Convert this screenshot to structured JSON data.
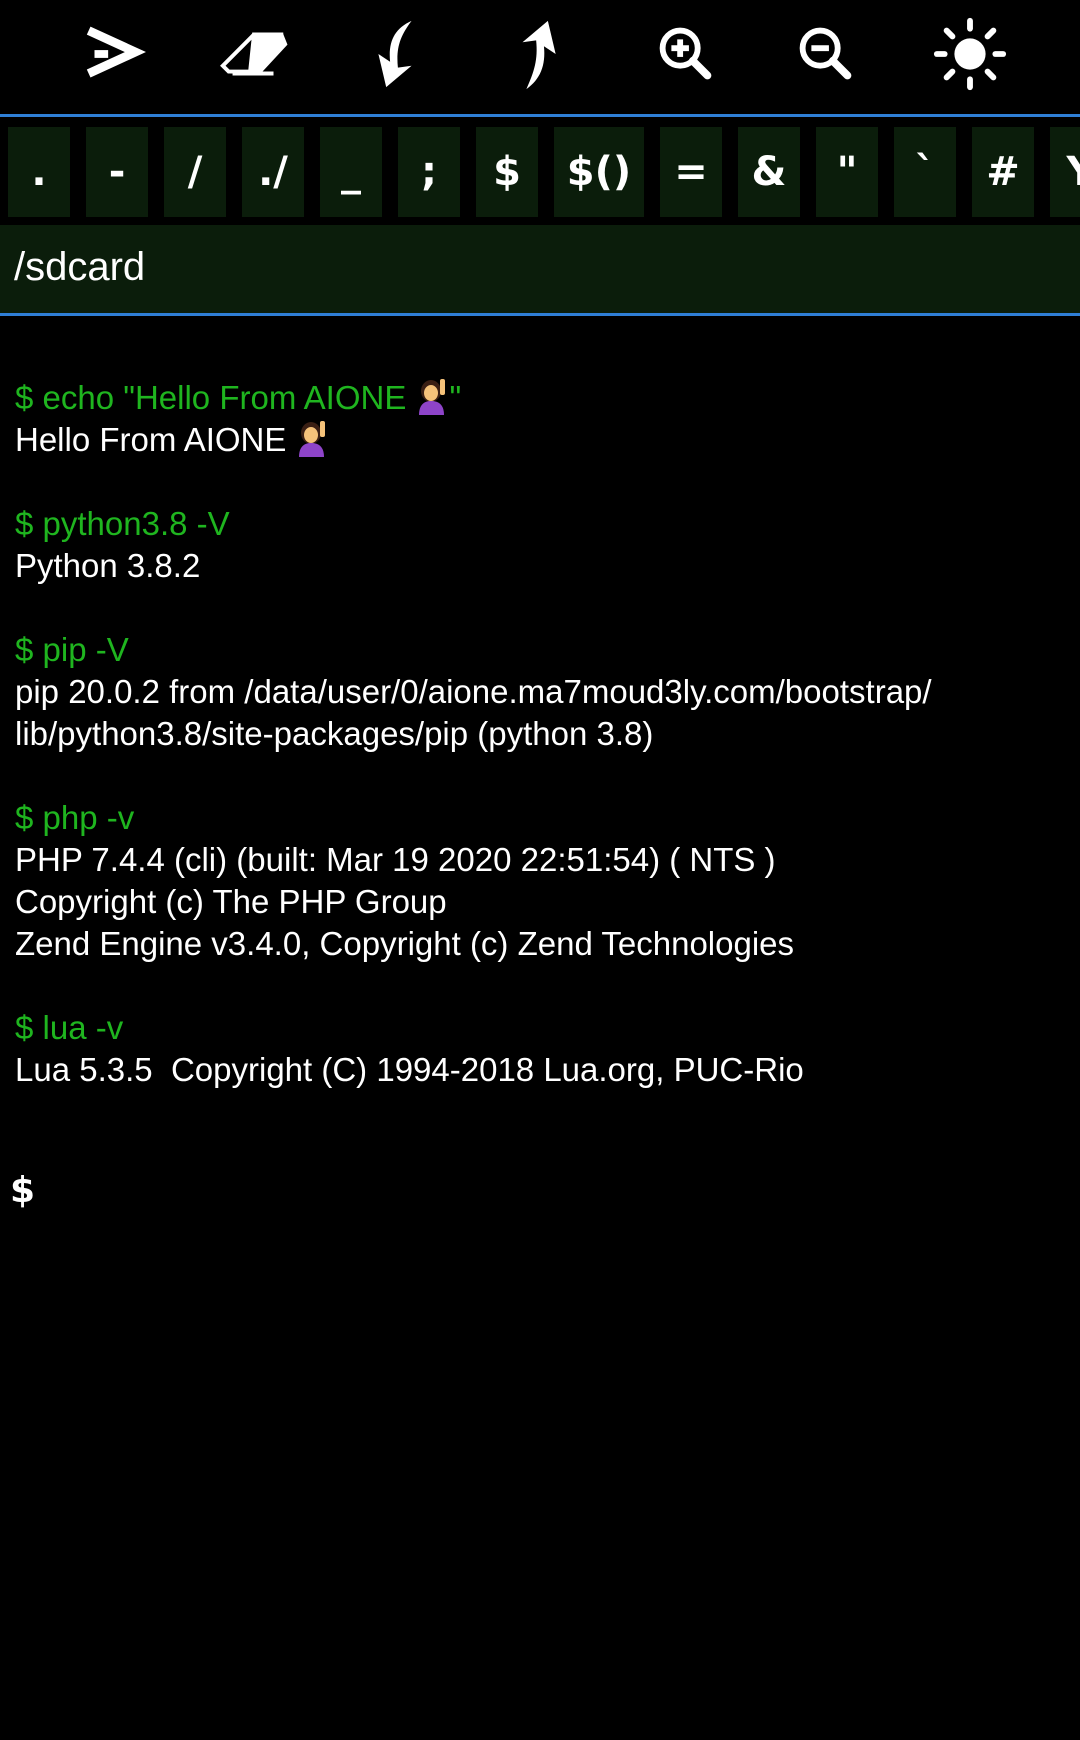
{
  "toolbar": {
    "icons": [
      "send-icon",
      "eraser-icon",
      "download-arrow-icon",
      "upload-arrow-icon",
      "zoom-in-icon",
      "zoom-out-icon",
      "brightness-icon"
    ]
  },
  "keys": [
    ".",
    "-",
    "/",
    "./",
    "_",
    ";",
    "$",
    "$()",
    "=",
    "&",
    "\"",
    "`",
    "#",
    "Y"
  ],
  "path": "/sdcard",
  "terminal": {
    "lines": [
      {
        "type": "cmd",
        "text": "$ echo \"Hello From AIONE ",
        "emoji": true,
        "suffix": "\""
      },
      {
        "type": "out",
        "text": "Hello From AIONE ",
        "emoji": true,
        "suffix": ""
      },
      {
        "type": "blank",
        "text": ""
      },
      {
        "type": "cmd",
        "text": "$ python3.8 -V"
      },
      {
        "type": "out",
        "text": "Python 3.8.2"
      },
      {
        "type": "blank",
        "text": ""
      },
      {
        "type": "cmd",
        "text": "$ pip -V"
      },
      {
        "type": "out",
        "text": "pip 20.0.2 from /data/user/0/aione.ma7moud3ly.com/bootstrap/"
      },
      {
        "type": "out",
        "text": "lib/python3.8/site-packages/pip (python 3.8)"
      },
      {
        "type": "blank",
        "text": ""
      },
      {
        "type": "cmd",
        "text": "$ php -v"
      },
      {
        "type": "out",
        "text": "PHP 7.4.4 (cli) (built: Mar 19 2020 22:51:54) ( NTS )"
      },
      {
        "type": "out",
        "text": "Copyright (c) The PHP Group"
      },
      {
        "type": "out",
        "text": "Zend Engine v3.4.0, Copyright (c) Zend Technologies"
      },
      {
        "type": "blank",
        "text": ""
      },
      {
        "type": "cmd",
        "text": "$ lua -v"
      },
      {
        "type": "out",
        "text": "Lua 5.3.5  Copyright (C) 1994-2018 Lua.org, PUC-Rio"
      }
    ],
    "prompt": "$"
  },
  "colors": {
    "command": "#1fb51f",
    "output": "#ffffff",
    "accent_border": "#2f7fd6",
    "key_bg": "#0b1d0b"
  }
}
